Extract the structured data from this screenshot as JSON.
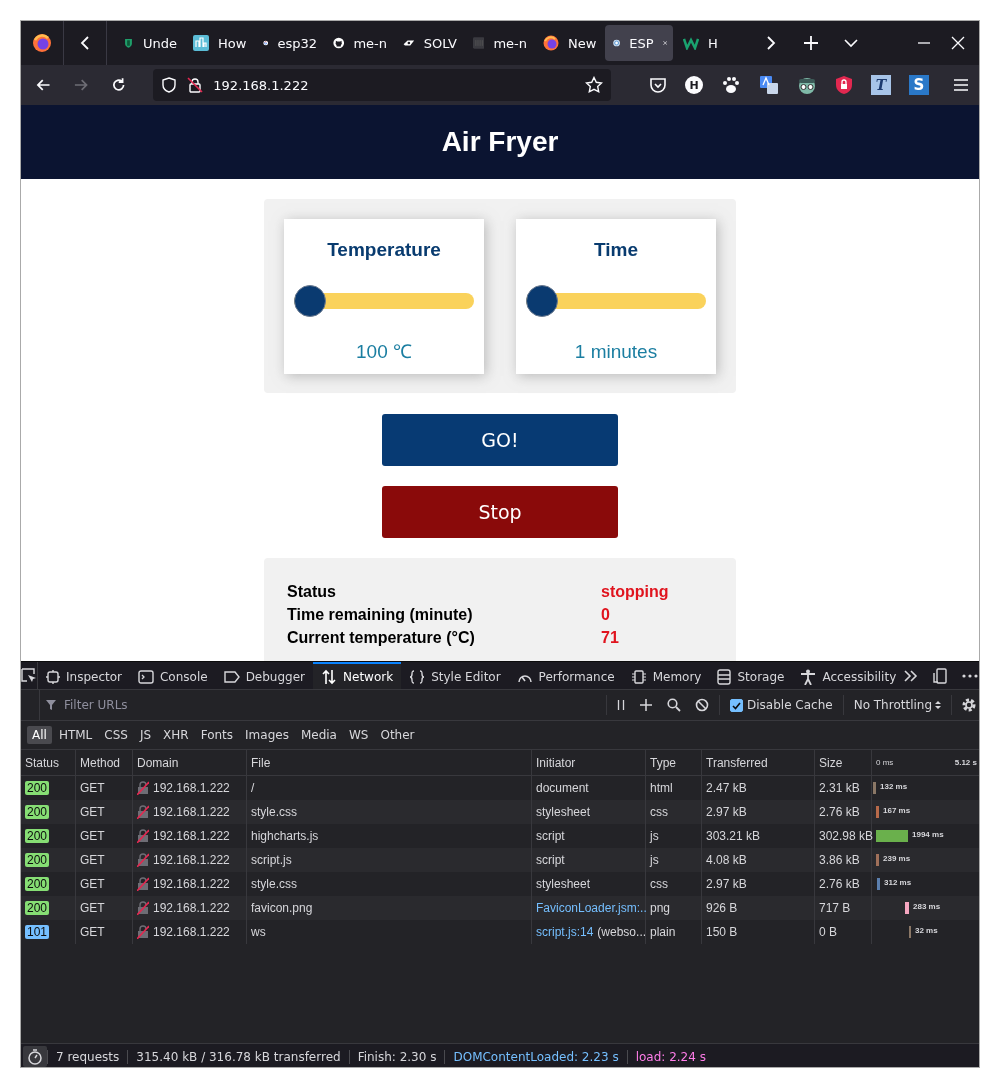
{
  "browser": {
    "tabs": [
      {
        "kind": "shield",
        "label": "Unde",
        "selected": false
      },
      {
        "kind": "chart",
        "label": "How",
        "selected": false
      },
      {
        "kind": "google",
        "label": "esp32",
        "selected": false
      },
      {
        "kind": "github",
        "label": "me-n",
        "selected": false
      },
      {
        "kind": "badge",
        "label": "SOLV",
        "selected": false
      },
      {
        "kind": "doc",
        "label": "me-n",
        "selected": false
      },
      {
        "kind": "firefox",
        "label": "New",
        "selected": false
      },
      {
        "kind": "globe",
        "label": "ESP",
        "selected": true
      },
      {
        "kind": "wix",
        "label": "H",
        "selected": false
      }
    ],
    "nav": [
      {
        "kind": "back",
        "disabled": false
      },
      {
        "kind": "forward",
        "disabled": true
      },
      {
        "kind": "reload",
        "disabled": false
      }
    ],
    "url": "192.168.1.222",
    "extensions": [
      {
        "kind": "pocket"
      },
      {
        "kind": "letter-circle",
        "text": "H"
      },
      {
        "kind": "paw"
      },
      {
        "kind": "translate"
      },
      {
        "kind": "spy"
      },
      {
        "kind": "shield"
      },
      {
        "kind": "letter-box",
        "text": "T"
      },
      {
        "kind": "letter-box-blue",
        "text": "S"
      }
    ]
  },
  "page": {
    "title": "Air Fryer",
    "controls": [
      {
        "label": "Temperature",
        "level": 0,
        "reading": "100 ℃"
      },
      {
        "label": "Time",
        "level": 0,
        "reading": "1 minutes"
      }
    ],
    "buttons": [
      {
        "kind": "start",
        "label": "GO!"
      },
      {
        "kind": "stop",
        "label": "Stop"
      }
    ],
    "status": [
      {
        "label": "Status",
        "value": "stopping"
      },
      {
        "label": "Time remaining (minute)",
        "value": "0"
      },
      {
        "label": "Current temperature (°C)",
        "value": "71"
      }
    ]
  },
  "devtools": {
    "tabs": [
      {
        "kind": "inspector",
        "label": "Inspector",
        "selected": false
      },
      {
        "kind": "console",
        "label": "Console",
        "selected": false
      },
      {
        "kind": "debugger",
        "label": "Debugger",
        "selected": false
      },
      {
        "kind": "network",
        "label": "Network",
        "selected": true
      },
      {
        "kind": "style",
        "label": "Style Editor",
        "selected": false
      },
      {
        "kind": "performance",
        "label": "Performance",
        "selected": false
      },
      {
        "kind": "memory",
        "label": "Memory",
        "selected": false
      },
      {
        "kind": "storage",
        "label": "Storage",
        "selected": false
      },
      {
        "kind": "accessibility",
        "label": "Accessibility",
        "selected": false
      }
    ],
    "filter": {
      "placeholder": "Filter URLs"
    },
    "disable_cache": {
      "label": "Disable Cache",
      "checked": true
    },
    "throttling": "No Throttling",
    "type_filters": [
      {
        "label": "All",
        "selected": true
      },
      {
        "label": "HTML",
        "selected": false
      },
      {
        "label": "CSS",
        "selected": false
      },
      {
        "label": "JS",
        "selected": false
      },
      {
        "label": "XHR",
        "selected": false
      },
      {
        "label": "Fonts",
        "selected": false
      },
      {
        "label": "Images",
        "selected": false
      },
      {
        "label": "Media",
        "selected": false
      },
      {
        "label": "WS",
        "selected": false
      },
      {
        "label": "Other",
        "selected": false
      }
    ],
    "columns": [
      "Status",
      "Method",
      "Domain",
      "File",
      "Initiator",
      "Type",
      "Transferred",
      "Size"
    ],
    "waterfall": {
      "start": "0 ms",
      "end": "5.12 s"
    },
    "rows": [
      {
        "status": "200",
        "color": "#86de74",
        "method": "GET",
        "domain": "192.168.1.222",
        "file": "/",
        "initiator": {
          "text": "document",
          "link": false
        },
        "type": "html",
        "transferred": "2.47 kB",
        "size": "2.31 kB",
        "time": "132 ms"
      },
      {
        "status": "200",
        "color": "#86de74",
        "method": "GET",
        "domain": "192.168.1.222",
        "file": "style.css",
        "initiator": {
          "text": "stylesheet",
          "link": false
        },
        "type": "css",
        "transferred": "2.97 kB",
        "size": "2.76 kB",
        "time": "167 ms"
      },
      {
        "status": "200",
        "color": "#86de74",
        "method": "GET",
        "domain": "192.168.1.222",
        "file": "highcharts.js",
        "initiator": {
          "text": "script",
          "link": false
        },
        "type": "js",
        "transferred": "303.21 kB",
        "size": "302.98 kB",
        "time": "1994 ms"
      },
      {
        "status": "200",
        "color": "#86de74",
        "method": "GET",
        "domain": "192.168.1.222",
        "file": "script.js",
        "initiator": {
          "text": "script",
          "link": false
        },
        "type": "js",
        "transferred": "4.08 kB",
        "size": "3.86 kB",
        "time": "239 ms"
      },
      {
        "status": "200",
        "color": "#86de74",
        "method": "GET",
        "domain": "192.168.1.222",
        "file": "style.css",
        "initiator": {
          "text": "stylesheet",
          "link": false
        },
        "type": "css",
        "transferred": "2.97 kB",
        "size": "2.76 kB",
        "time": "312 ms"
      },
      {
        "status": "200",
        "color": "#86de74",
        "method": "GET",
        "domain": "192.168.1.222",
        "file": "favicon.png",
        "initiator": {
          "text": "FaviconLoader.jsm:...",
          "link": true
        },
        "type": "png",
        "transferred": "926 B",
        "size": "717 B",
        "time": "283 ms"
      },
      {
        "status": "101",
        "color": "#75bfff",
        "method": "GET",
        "domain": "192.168.1.222",
        "file": "ws",
        "initiator": {
          "text": "script.js:14",
          "link": true,
          "note": "(webso..."
        },
        "type": "plain",
        "transferred": "150 B",
        "size": "0 B",
        "time": "32 ms"
      }
    ],
    "summary": {
      "requests": "7 requests",
      "transferred": "315.40 kB / 316.78 kB transferred",
      "finish": "Finish: 2.30 s",
      "dom_loaded": "DOMContentLoaded: 2.23 s",
      "load": "load: 2.24 s"
    }
  }
}
